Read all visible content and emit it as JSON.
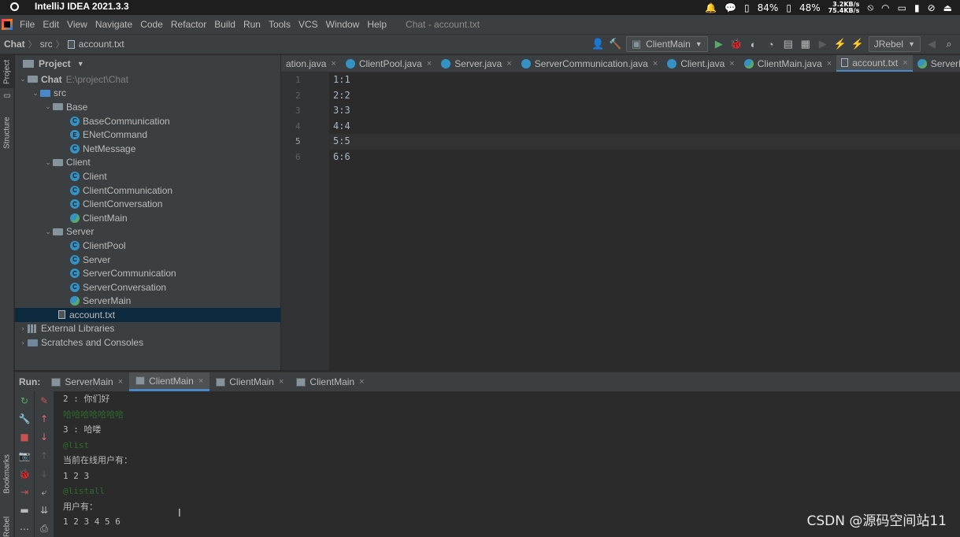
{
  "os_bar": {
    "app_title": "IntelliJ IDEA 2021.3.3",
    "battery1": "84%",
    "battery2": "48%",
    "net_up": "3.2KB/s",
    "net_down": "75.4KB/s"
  },
  "menu": {
    "items": [
      "File",
      "Edit",
      "View",
      "Navigate",
      "Code",
      "Refactor",
      "Build",
      "Run",
      "Tools",
      "VCS",
      "Window",
      "Help"
    ],
    "window_title": "Chat - account.txt"
  },
  "breadcrumb": {
    "project": "Chat",
    "folder": "src",
    "file": "account.txt"
  },
  "toolbar": {
    "run_config": "ClientMain",
    "jrebel": "JRebel"
  },
  "left_stripe": {
    "project": "Project",
    "structure": "Structure",
    "bookmarks": "Bookmarks",
    "jrebel": "JRebel"
  },
  "project_panel": {
    "title": "Project",
    "root": {
      "name": "Chat",
      "path": "E:\\project\\Chat"
    },
    "src": "src",
    "base": {
      "name": "Base",
      "children": [
        "BaseCommunication",
        "ENetCommand",
        "NetMessage"
      ]
    },
    "client": {
      "name": "Client",
      "children": [
        "Client",
        "ClientCommunication",
        "ClientConversation",
        "ClientMain"
      ]
    },
    "server": {
      "name": "Server",
      "children": [
        "ClientPool",
        "Server",
        "ServerCommunication",
        "ServerConversation",
        "ServerMain"
      ]
    },
    "file": "account.txt",
    "external": "External Libraries",
    "scratches": "Scratches and Consoles"
  },
  "editor": {
    "tabs": [
      "ation.java",
      "ClientPool.java",
      "Server.java",
      "ServerCommunication.java",
      "Client.java",
      "ClientMain.java",
      "account.txt",
      "ServerM"
    ],
    "line_numbers": [
      "1",
      "2",
      "3",
      "4",
      "5",
      "6"
    ],
    "lines": [
      "1:1",
      "2:2",
      "3:3",
      "4:4",
      "5:5",
      "6:6"
    ],
    "current_line": 5
  },
  "run": {
    "label": "Run:",
    "tabs": [
      "ServerMain",
      "ClientMain",
      "ClientMain",
      "ClientMain"
    ],
    "console": [
      {
        "text": "2 : 你们好",
        "kind": "out"
      },
      {
        "text": "哈哈哈哈哈哈哈",
        "kind": "input"
      },
      {
        "text": "3 : 哈喽",
        "kind": "out"
      },
      {
        "text": "@list",
        "kind": "input"
      },
      {
        "text": "当前在线用户有：",
        "kind": "out"
      },
      {
        "text": "1 2 3",
        "kind": "out"
      },
      {
        "text": "@listall",
        "kind": "input"
      },
      {
        "text": "用户有：",
        "kind": "out"
      },
      {
        "text": "1 2 3 4 5 6",
        "kind": "out"
      }
    ]
  },
  "watermark": "CSDN @源码空间站11"
}
